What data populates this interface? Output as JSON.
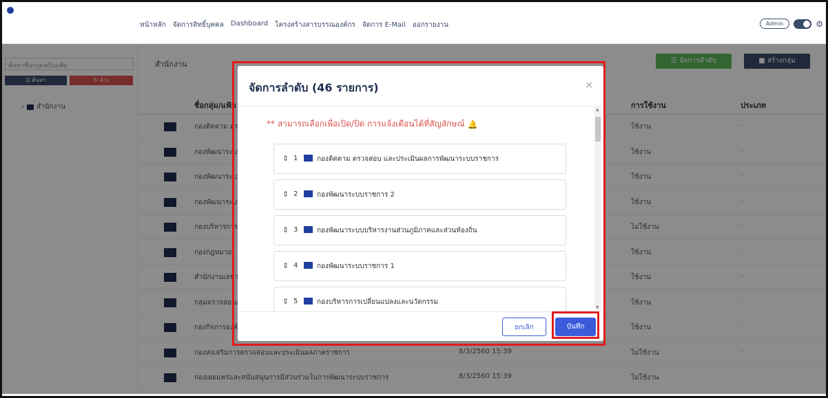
{
  "nav": {
    "items": [
      "หน้าหลัก",
      "จัดการสิทธิ์บุคคล",
      "Dashboard",
      "โครงสร้างสารบรรณองค์กร",
      "จัดการ E-Mail",
      "ออกรายงาน"
    ],
    "admin_label": "Admin"
  },
  "sidebar": {
    "search_placeholder": "ค้นหาชื่อกลุ่มหรือแฟ้ม",
    "search_button": "Q ค้นหา",
    "clear_button": "↻ ล้าง",
    "tree_root": "สำนักงาน"
  },
  "main": {
    "title": "สำนักงาน",
    "order_button": "☰ จัดการลำดับ",
    "create_button": "สร้างกลุ่ม",
    "columns": {
      "name": "ชื่อกลุ่ม/แฟ้ม",
      "status": "การใช้งาน",
      "type": "ประเภท"
    },
    "rows": [
      {
        "name": "กองติดตาม ตรวจสอบ และประเมินผลการพัฒนาระบบราชการ",
        "date": "",
        "status": "ใช้งาน",
        "type": "-"
      },
      {
        "name": "กองพัฒนาระบบราชการ 2",
        "date": "",
        "status": "ใช้งาน",
        "type": "-"
      },
      {
        "name": "กองพัฒนาระบบบริหารงานส่วนภูมิภาคและส่วนท้องถิ่น",
        "date": "",
        "status": "ใช้งาน",
        "type": "-"
      },
      {
        "name": "กองพัฒนาระบบราชการ 1",
        "date": "",
        "status": "ใช้งาน",
        "type": "-"
      },
      {
        "name": "กองบริหารการเปลี่ยนแปลงและนวัตกรรม",
        "date": "",
        "status": "ไม่ใช้งาน",
        "type": "-"
      },
      {
        "name": "กองกฎหมาย",
        "date": "",
        "status": "ใช้งาน",
        "type": "-"
      },
      {
        "name": "สำนักงานเลขานุการกรม",
        "date": "",
        "status": "ใช้งาน",
        "type": "-"
      },
      {
        "name": "กลุ่มตรวจสอบภายใน",
        "date": "",
        "status": "ใช้งาน",
        "type": "-"
      },
      {
        "name": "กองกิจการองค์กร",
        "date": "",
        "status": "ใช้งาน",
        "type": "-"
      },
      {
        "name": "กองส่งเสริมการตรวจสอบและประเมินผลภาคราชการ",
        "date": "8/3/2560 15:39",
        "status": "ไม่ใช้งาน",
        "type": "-"
      },
      {
        "name": "กองเผยแพร่และสนับสนุนการมีส่วนร่วมในการพัฒนาระบบราชการ",
        "date": "8/3/2560 15:39",
        "status": "ไม่ใช้งาน",
        "type": "-"
      }
    ]
  },
  "modal": {
    "title": "จัดการลำดับ (46 รายการ)",
    "notice": "** สามารถเลือกเพื่อเปิด/ปิด การแจ้งเตือนได้ที่สัญลักษณ์",
    "items": [
      {
        "num": "1",
        "label": "กองติดตาม ตรวจสอบ และประเมินผลการพัฒนาระบบราชการ"
      },
      {
        "num": "2",
        "label": "กองพัฒนาระบบราชการ 2"
      },
      {
        "num": "3",
        "label": "กองพัฒนาระบบบริหารงานส่วนภูมิภาคและส่วนท้องถิ่น"
      },
      {
        "num": "4",
        "label": "กองพัฒนาระบบราชการ 1"
      },
      {
        "num": "5",
        "label": "กองบริหารการเปลี่ยนแปลงและนวัตกรรม"
      }
    ],
    "cancel_label": "ยกเลิก",
    "save_label": "บันทึก"
  },
  "colors": {
    "primary": "#3b5bdb",
    "nav": "#3b4a6b",
    "highlight": "#e21b1b",
    "notice": "#d9534f"
  }
}
